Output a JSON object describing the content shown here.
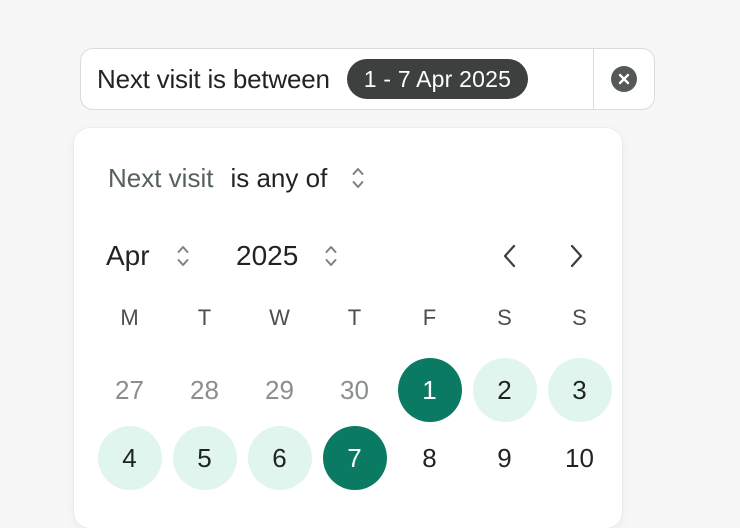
{
  "filter": {
    "label": "Next visit is between",
    "value": "1 - 7 Apr 2025"
  },
  "condition": {
    "field": "Next visit",
    "operator": "is any of"
  },
  "calendar": {
    "month": "Apr",
    "year": "2025",
    "weekdays": [
      "M",
      "T",
      "W",
      "T",
      "F",
      "S",
      "S"
    ],
    "weeks": [
      [
        {
          "day": "27",
          "state": "outside"
        },
        {
          "day": "28",
          "state": "outside"
        },
        {
          "day": "29",
          "state": "outside"
        },
        {
          "day": "30",
          "state": "outside"
        },
        {
          "day": "1",
          "state": "endpoint"
        },
        {
          "day": "2",
          "state": "in-range"
        },
        {
          "day": "3",
          "state": "in-range"
        }
      ],
      [
        {
          "day": "4",
          "state": "in-range"
        },
        {
          "day": "5",
          "state": "in-range"
        },
        {
          "day": "6",
          "state": "in-range"
        },
        {
          "day": "7",
          "state": "endpoint"
        },
        {
          "day": "8",
          "state": "normal"
        },
        {
          "day": "9",
          "state": "normal"
        },
        {
          "day": "10",
          "state": "normal"
        }
      ]
    ]
  },
  "colors": {
    "accent": "#0b7a63",
    "range": "#dff5ee",
    "pill": "#3c403e"
  },
  "icons": {
    "clear": "close-circle-icon",
    "updown": "chevron-up-down-icon",
    "prev": "chevron-left-icon",
    "next": "chevron-right-icon"
  }
}
